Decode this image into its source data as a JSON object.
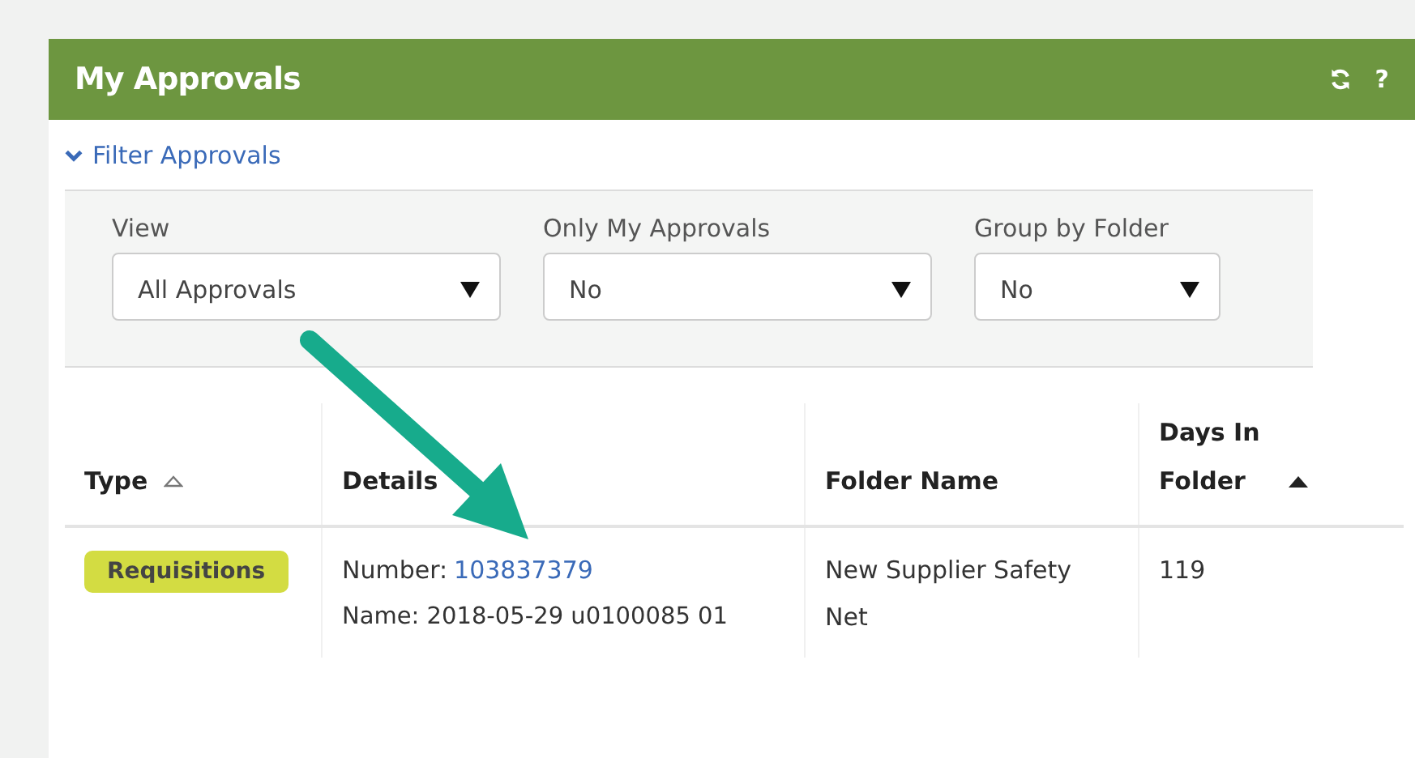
{
  "panel": {
    "title": "My Approvals",
    "actions": [
      {
        "kind": "refresh"
      },
      {
        "kind": "help",
        "label": "?"
      }
    ]
  },
  "filter": {
    "label": "Filter Approvals",
    "expanded": true,
    "fields": [
      {
        "label": "View",
        "value": "All Approvals"
      },
      {
        "label": "Only My Approvals",
        "value": "No"
      },
      {
        "label": "Group by Folder",
        "value": "No"
      }
    ]
  },
  "table": {
    "columns": [
      {
        "label": "Type",
        "sorted": false
      },
      {
        "label": "Details"
      },
      {
        "label": "Folder Name"
      },
      {
        "label": "Days In Folder",
        "sorted": true
      }
    ],
    "rows": [
      {
        "type": "Requisitions",
        "number_label": "Number:",
        "number": "103837379",
        "name": "Name: 2018-05-29 u0100085 01",
        "folder": "New Supplier Safety Net",
        "days": "119"
      }
    ]
  }
}
